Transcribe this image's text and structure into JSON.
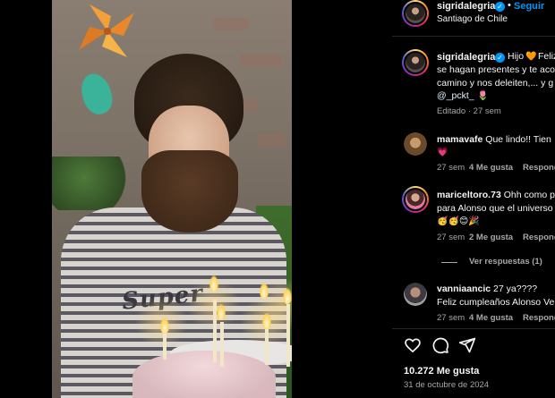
{
  "post": {
    "author": "sigridalegria",
    "follow_label": "Seguir",
    "separator": "•",
    "location": "Santiago de Chile",
    "shirt_print": "Super",
    "caption": {
      "line1_start": "Hijo",
      "line1_heart": "🧡",
      "line1_rest": "Feliz",
      "line2": "se hagan presentes y te aco",
      "line3": "camino y nos deleiten,... y g",
      "mention": "@_pckt_",
      "mention_emoji": "🌷",
      "meta": "Editado · 27 sem"
    },
    "likes": "10.272 Me gusta",
    "date": "31 de octubre de 2024"
  },
  "comments": [
    {
      "user": "mamavafe",
      "text_line1": "Que lindo!! Tien",
      "text_line2": "",
      "emoji": "💗",
      "time": "27 sem",
      "likes": "4 Me gusta",
      "reply": "Respond"
    },
    {
      "user": "mariceltoro.73",
      "text_line1": "Ohh como p",
      "text_line2": "para Alonso que el universo",
      "emoji": "🥳🥳😊🎉",
      "time": "27 sem",
      "likes": "2 Me gusta",
      "reply": "Respond",
      "view_replies": "Ver respuestas (1)"
    },
    {
      "user": "vanniaancic",
      "text_line1": "27 ya????",
      "text_line2": "Feliz cumpleaños Alonso Ve",
      "emoji": "",
      "time": "27 sem",
      "likes": "4 Me gusta",
      "reply": "Respond"
    }
  ],
  "actions": [
    "like-icon",
    "comment-icon",
    "share-icon"
  ],
  "colors": {
    "accent": "#0095f6",
    "secondary_text": "#a8a8a8",
    "background": "#000000"
  }
}
